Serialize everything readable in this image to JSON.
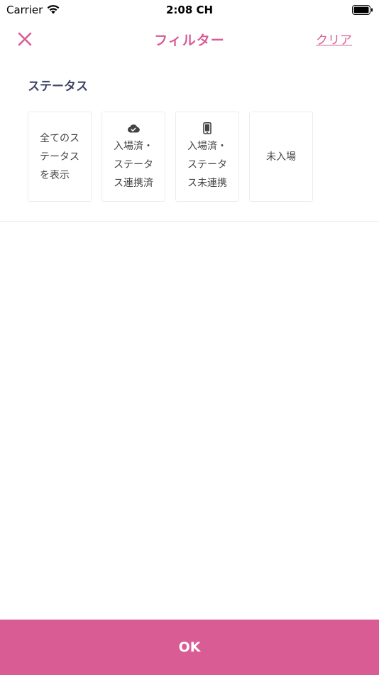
{
  "status_bar": {
    "carrier": "Carrier",
    "time": "2:08 CH"
  },
  "nav": {
    "title": "フィルター",
    "clear_label": "クリア"
  },
  "section": {
    "title": "ステータス"
  },
  "cards": [
    {
      "label": "全てのス\nテータス\nを表示",
      "icon": ""
    },
    {
      "label": "入場済・\nステータ\nス連携済",
      "icon": "cloud-check-icon"
    },
    {
      "label": "入場済・\nステータ\nス未連携",
      "icon": "smartphone-icon"
    },
    {
      "label": "未入場",
      "icon": ""
    }
  ],
  "footer": {
    "ok_label": "OK"
  },
  "colors": {
    "accent": "#d95c94",
    "section_title": "#3d4566"
  }
}
